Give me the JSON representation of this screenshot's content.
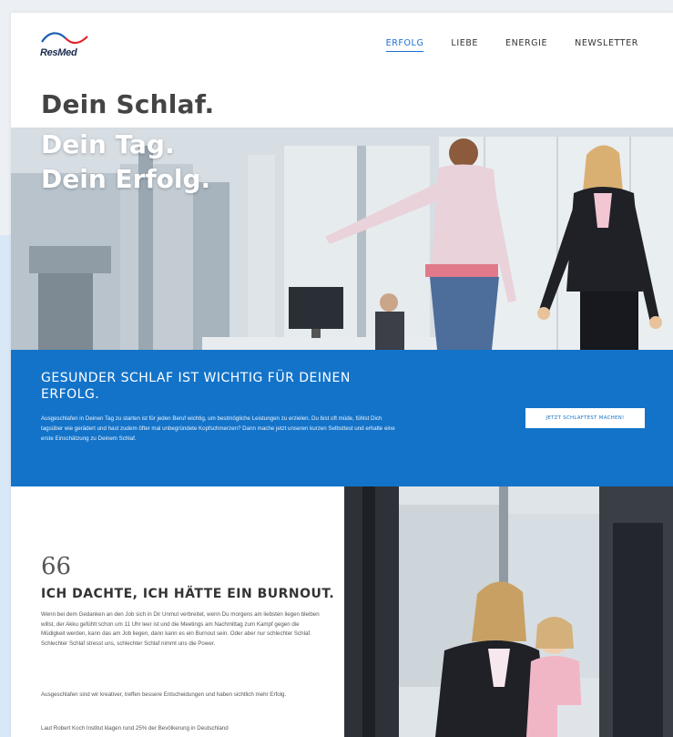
{
  "brand": {
    "logo_text": "ResMed"
  },
  "nav": {
    "items": [
      {
        "label": "ERFOLG",
        "active": true
      },
      {
        "label": "LIEBE",
        "active": false
      },
      {
        "label": "ENERGIE",
        "active": false
      },
      {
        "label": "NEWSLETTER",
        "active": false
      }
    ]
  },
  "hero": {
    "line1": "Dein Schlaf.",
    "line2": "Dein Tag.",
    "line3": "Dein Erfolg."
  },
  "band": {
    "heading": "GESUNDER SCHLAF IST WICHTIG FÜR DEINEN ERFOLG.",
    "text": "Ausgeschlafen in Deinen Tag zu starten ist für jeden Beruf wichtig, um bestmögliche Leistungen zu erzielen. Du bist oft müde, fühlst Dich tagsüber wie gerädert und hast zudem öfter mal unbegründete Kopfschmerzen? Dann mache jetzt unseren kurzen Selbsttest und erhalte eine erste Einschätzung zu Deinem Schlaf.",
    "button_label": "JETZT SCHLAFTEST MACHEN!"
  },
  "testimonial": {
    "quote_mark": "66",
    "heading": "ICH DACHTE, ICH HÄTTE EIN BURNOUT.",
    "p1": "Wenn bei dem Gedanken an den Job sich in Dir Unmut verbreitet, wenn Du morgens am liebsten liegen bleiben willst, der Akku gefühlt schon um 11 Uhr leer ist und die Meetings am Nachmittag zum Kampf gegen die Müdigkeit werden, kann das am Job liegen, dann kann es ein Burnout sein. Oder aber nur schlechter Schlaf. Schlechter Schlaf stresst uns, schlechter Schlaf nimmt uns die Power.",
    "p2": "Ausgeschlafen sind wir kreativer, treffen bessere Entscheidungen und haben sichtlich mehr Erfolg.",
    "p3": "Laut Robert Koch Institut klagen rund 25% der Bevölkerung in Deutschland"
  },
  "colors": {
    "accent": "#1373c9",
    "nav_active": "#1a6fd0",
    "logo_red": "#e0242a",
    "logo_blue": "#1b5fb0"
  }
}
